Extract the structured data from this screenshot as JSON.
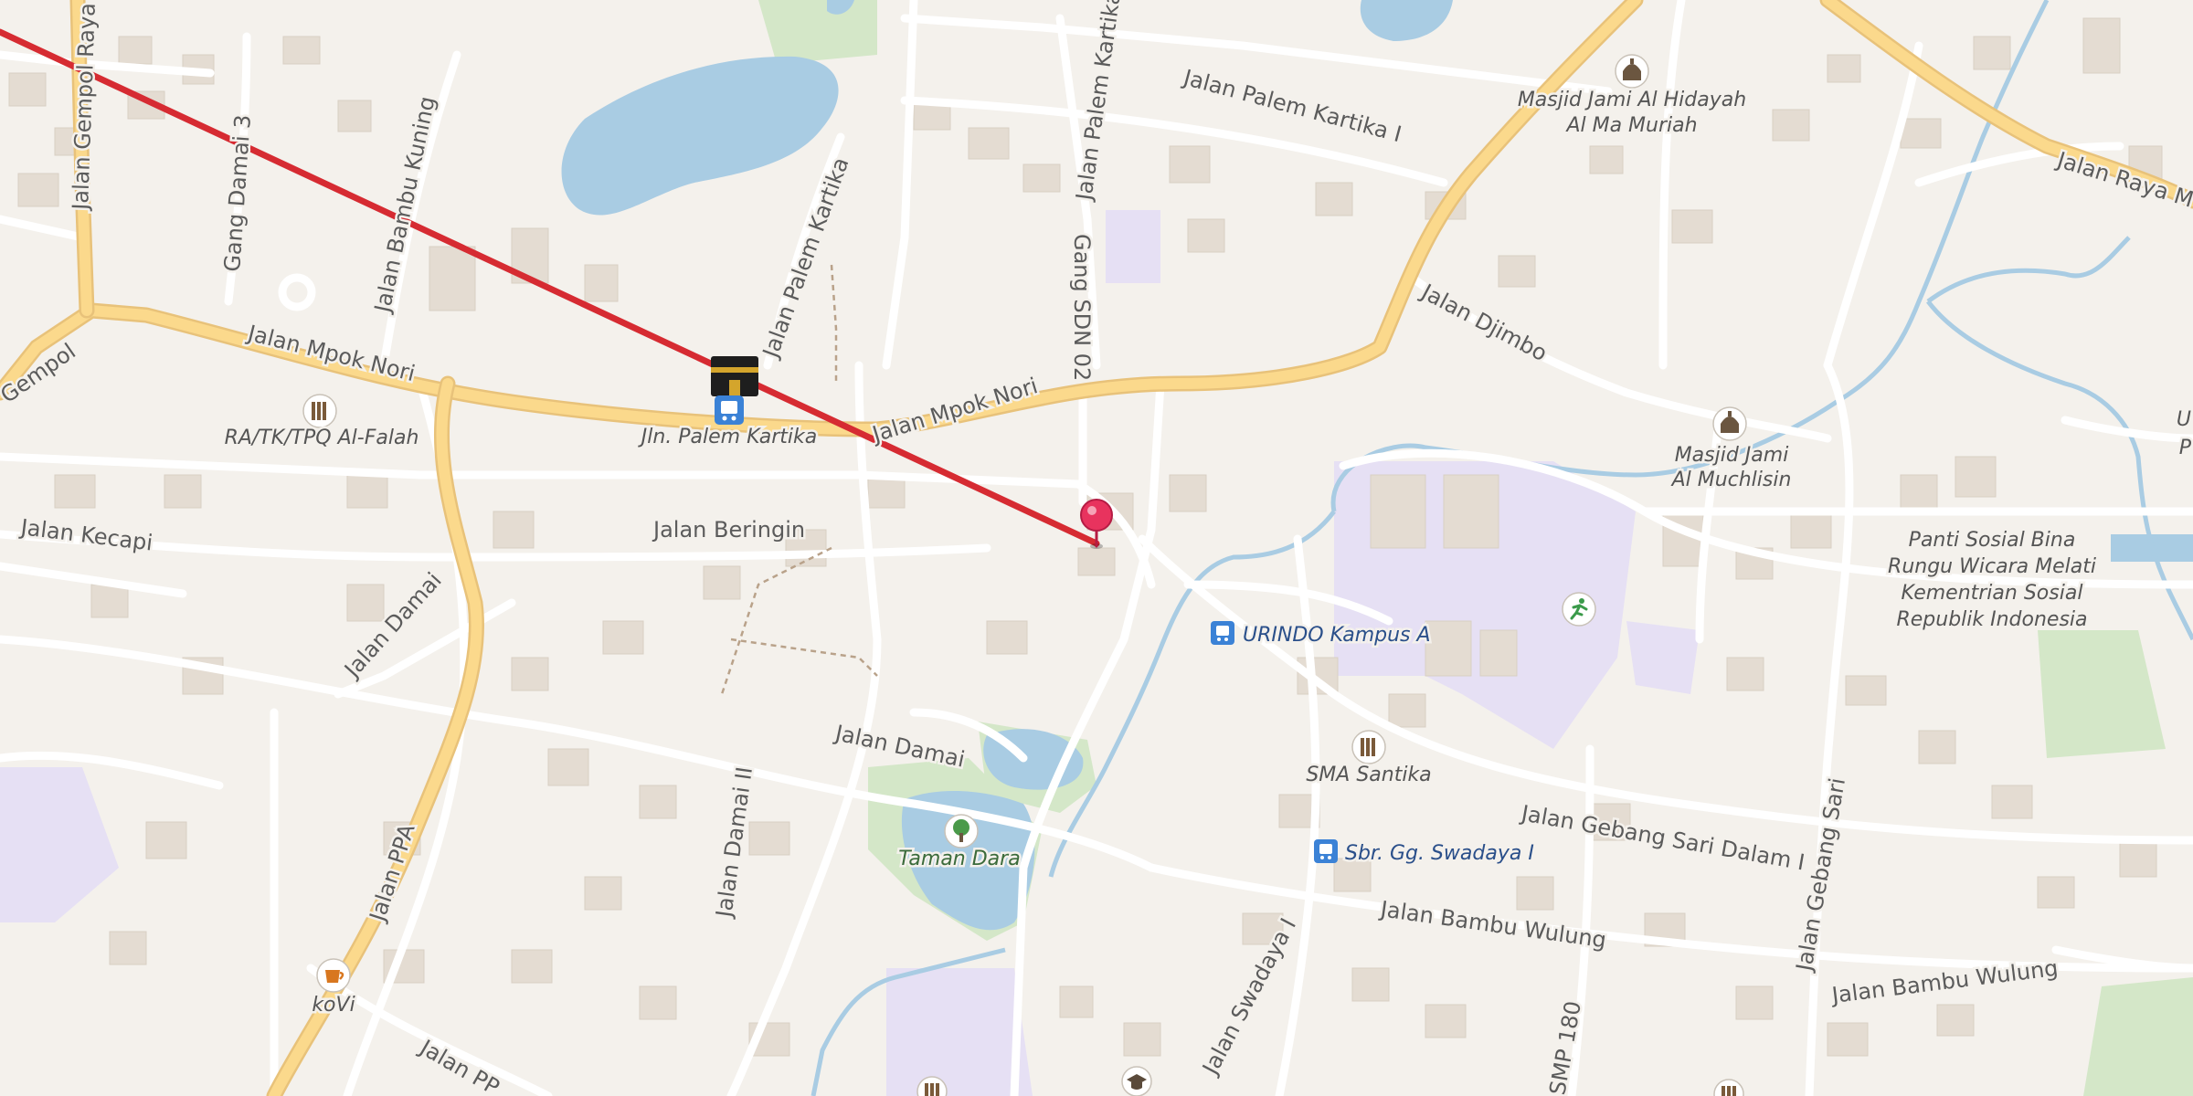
{
  "map": {
    "colors": {
      "background": "#f4f1ec",
      "major_road": "#fbd98c",
      "minor_road": "#ffffff",
      "water": "#a9cce3",
      "route_line": "#d62b32",
      "marker": "#e8335e",
      "bus_stop": "#3b82d6",
      "campus": "#e6e0f4",
      "park": "#d4e7c8"
    },
    "streets": {
      "jalan_gempol_raya": "Jalan Gempol Raya",
      "gempol": "Gempol",
      "gang_damai_3": "Gang Damai 3",
      "jalan_bambu_kuning": "Jalan Bambu Kuning",
      "jalan_palem_kartika_west": "Jalan Palem Kartika",
      "jalan_palem_kartika_north": "Jalan Palem Kartika",
      "jalan_palem_kartika_i": "Jalan Palem Kartika I",
      "gang_sdn_02": "Gang SDN 02",
      "jalan_mpok_nori_west": "Jalan Mpok Nori",
      "jalan_mpok_nori_east": "Jalan Mpok Nori",
      "jalan_beringin": "Jalan Beringin",
      "jalan_kecapi": "Jalan Kecapi",
      "jalan_damai_west": "Jalan Damai",
      "jalan_damai_center": "Jalan Damai",
      "jalan_damai_ii": "Jalan Damai II",
      "jalan_ppa": "Jalan PPA",
      "jalan_pp_partial": "Jalan PP",
      "jalan_djimbo": "Jalan Djimbo",
      "jalan_raya_partial": "Jalan Raya M",
      "jalan_gebang_sari_dalam_i": "Jalan Gebang Sari Dalam I",
      "jalan_gebang_sari": "Jalan Gebang Sari",
      "jalan_bambu_wulung_center": "Jalan Bambu Wulung",
      "jalan_bambu_wulung_east": "Jalan Bambu Wulung",
      "jalan_swadaya_i": "Jalan Swadaya I",
      "smp_180": "SMP 180"
    },
    "pois": {
      "masjid_al_hidayah_line1": "Masjid Jami Al Hidayah",
      "masjid_al_hidayah_line2": "Al Ma Muriah",
      "masjid_al_muchlisin_line1": "Masjid Jami",
      "masjid_al_muchlisin_line2": "Al Muchlisin",
      "ra_tk_tpq": "RA/TK/TPQ Al-Falah",
      "panti_line1": "Panti Sosial Bina",
      "panti_line2": "Rungu Wicara Melati",
      "panti_line3": "Kementrian Sosial",
      "panti_line4": "Republik Indonesia",
      "sma_santika": "SMA Santika",
      "taman_dara": "Taman Dara",
      "kovi": "koVi",
      "edge_u": "U",
      "edge_p": "P"
    },
    "transit": {
      "jln_palem_kartika": "Jln. Palem Kartika",
      "urindo_kampus_a": "URINDO Kampus A",
      "sbr_gg_swadaya_i": "Sbr. Gg. Swadaya I"
    },
    "icons": {
      "kaaba": "kaaba-icon",
      "marker": "map-pin-icon",
      "bus": "bus-stop-icon",
      "mosque": "mosque-icon",
      "school": "school-icon",
      "park": "tree-icon",
      "cafe": "coffee-icon",
      "sports": "running-icon",
      "university": "graduation-cap-icon"
    }
  }
}
